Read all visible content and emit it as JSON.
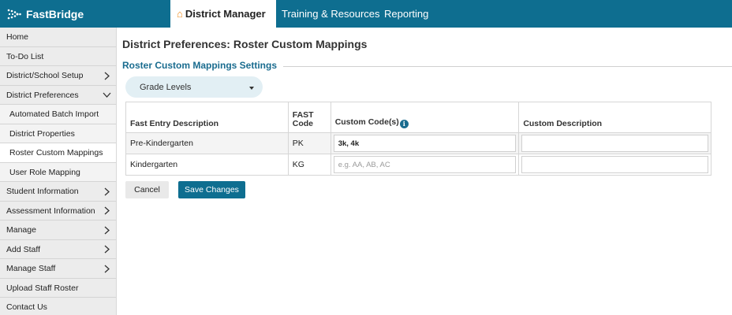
{
  "header": {
    "logo_text": "FastBridge",
    "tabs": [
      {
        "label": "District Manager",
        "icon": "home-icon",
        "active": true
      },
      {
        "label": "Training & Resources"
      },
      {
        "label": "Reporting"
      }
    ]
  },
  "sidebar": {
    "items": [
      {
        "label": "Home"
      },
      {
        "label": "To-Do List"
      },
      {
        "label": "District/School Setup",
        "chevron": "right"
      },
      {
        "label": "District Preferences",
        "chevron": "down"
      },
      {
        "label": "Automated Batch Import",
        "sub": true
      },
      {
        "label": "District Properties",
        "sub": true
      },
      {
        "label": "Roster Custom Mappings",
        "sub": true,
        "selected": true
      },
      {
        "label": "User Role Mapping",
        "sub": true
      },
      {
        "label": "Student Information",
        "chevron": "right"
      },
      {
        "label": "Assessment Information",
        "chevron": "right"
      },
      {
        "label": "Manage",
        "chevron": "right"
      },
      {
        "label": "Add Staff",
        "chevron": "right"
      },
      {
        "label": "Manage Staff",
        "chevron": "right"
      },
      {
        "label": "Upload Staff Roster"
      },
      {
        "label": "Contact Us"
      }
    ]
  },
  "main": {
    "page_title": "District Preferences: Roster Custom Mappings",
    "section_title": "Roster Custom Mappings Settings",
    "dropdown_value": "Grade Levels",
    "table": {
      "headers": {
        "desc": "Fast Entry Description",
        "code_line1": "FAST",
        "code_line2": "Code",
        "custom_codes": "Custom Code(s)",
        "custom_desc": "Custom Description"
      },
      "rows": [
        {
          "desc": "Pre-Kindergarten",
          "code": "PK",
          "custom_codes": "3k, 4k",
          "custom_codes_placeholder": "",
          "custom_desc": ""
        },
        {
          "desc": "Kindergarten",
          "code": "KG",
          "custom_codes": "",
          "custom_codes_placeholder": "e.g. AA, AB, AC",
          "custom_desc": ""
        }
      ]
    },
    "buttons": {
      "cancel": "Cancel",
      "save": "Save Changes"
    }
  },
  "colors": {
    "brand": "#0e6e90",
    "accent": "#1a6c8f",
    "home_icon": "#f08a1a"
  }
}
